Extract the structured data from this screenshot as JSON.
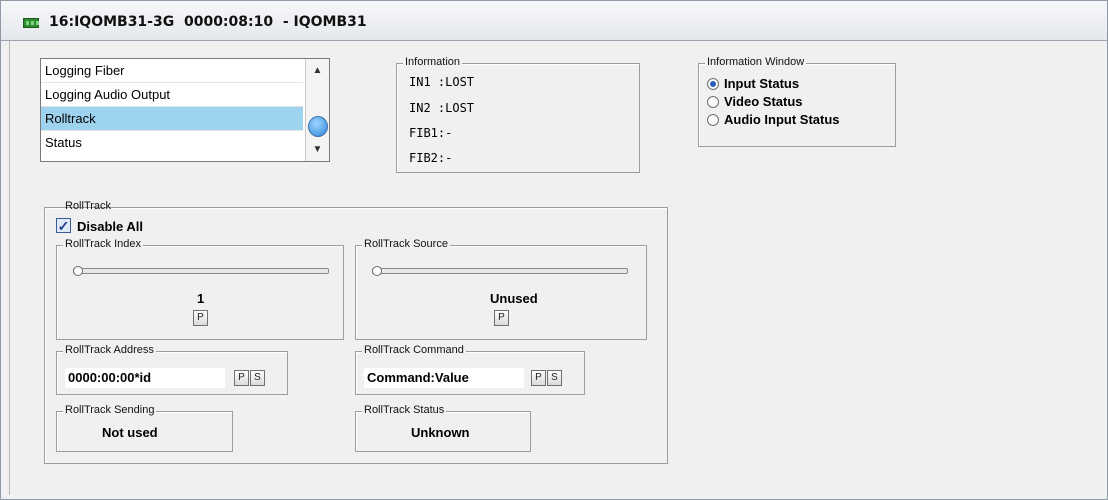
{
  "window": {
    "title": "16:IQOMB31-3G  0000:08:10  - IQOMB31"
  },
  "menu_list": {
    "items": [
      {
        "label": "Logging Fiber"
      },
      {
        "label": "Logging Audio Output"
      },
      {
        "label": "Rolltrack"
      },
      {
        "label": "Status"
      }
    ],
    "selected": "Rolltrack"
  },
  "information": {
    "title": "Information",
    "lines": [
      "IN1 :LOST",
      "IN2 :LOST",
      "FIB1:-",
      "FIB2:-"
    ]
  },
  "information_window": {
    "title": "Information Window",
    "options": [
      {
        "label": "Input Status",
        "selected": true
      },
      {
        "label": "Video Status",
        "selected": false
      },
      {
        "label": "Audio Input Status",
        "selected": false
      }
    ]
  },
  "rolltrack": {
    "title": "RollTrack",
    "disable_all_label": "Disable All",
    "disable_all_checked": true,
    "index": {
      "title": "RollTrack Index",
      "value": "1",
      "button_label": "P",
      "slider_fraction": 0.0
    },
    "source": {
      "title": "RollTrack Source",
      "value": "Unused",
      "button_label": "P",
      "slider_fraction": 0.0
    },
    "address": {
      "title": "RollTrack Address",
      "value": "0000:00:00*id",
      "p_label": "P",
      "s_label": "S"
    },
    "command": {
      "title": "RollTrack Command",
      "value": "Command:Value",
      "p_label": "P",
      "s_label": "S"
    },
    "sending": {
      "title": "RollTrack Sending",
      "value": "Not used"
    },
    "status": {
      "title": "RollTrack Status",
      "value": "Unknown"
    }
  }
}
